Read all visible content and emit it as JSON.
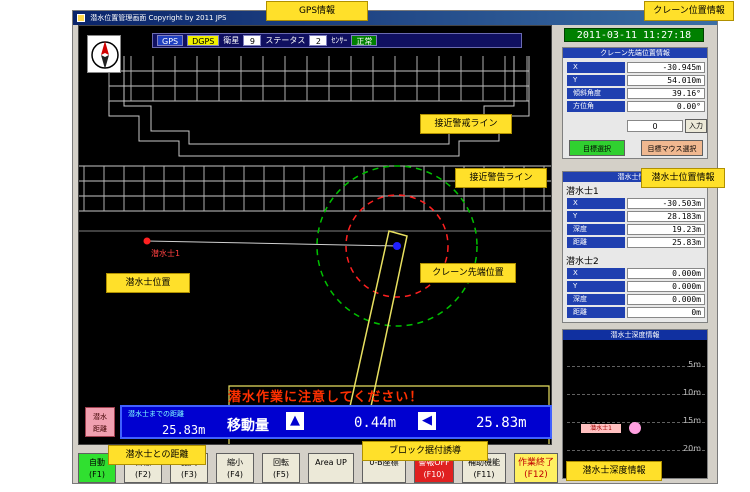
{
  "window": {
    "title": "潜水位置管理画面  Copyright by 2011 JPS"
  },
  "status_bar": {
    "gps": "GPS",
    "dgps": "DGPS",
    "sat_label": "衛星",
    "sat_count": "9",
    "status_label": "ステータス",
    "status_value": "2",
    "sensor_label": "ｾﾝｻｰ",
    "sensor_state": "正常"
  },
  "map": {
    "diver1_label": "潜水士1",
    "warning": "潜水作業に注意してください！"
  },
  "move_bar": {
    "caption": "潜水士までの距離",
    "diver_distance": "25.83m",
    "move_label": "移動量",
    "vertical_move": "0.44m",
    "horizontal_move": "25.83m"
  },
  "diver_dist_button": {
    "line1": "潜水",
    "line2": "距離"
  },
  "fkeys": [
    {
      "line1": "自動",
      "line2": "(F1)",
      "color": "green"
    },
    {
      "line1": "目標",
      "line2": "(F2)",
      "color": ""
    },
    {
      "line1": "拡大",
      "line2": "(F3)",
      "color": ""
    },
    {
      "line1": "縮小",
      "line2": "(F4)",
      "color": ""
    },
    {
      "line1": "回転",
      "line2": "(F5)",
      "color": ""
    },
    {
      "line1": "Area UP",
      "line2": "",
      "color": ""
    },
    {
      "line1": "0-B座標",
      "line2": "",
      "color": ""
    },
    {
      "line1": "警報OFF",
      "line2": "(F10)",
      "color": "red"
    },
    {
      "line1": "補助機能",
      "line2": "(F11)",
      "color": ""
    },
    {
      "line1": "作業終了",
      "line2": "(F12)",
      "color": "yellow"
    }
  ],
  "right": {
    "datetime": "2011-03-11  11:27:18",
    "crane_title": "クレーン先端位置情報",
    "crane_rows": [
      {
        "k": "X",
        "v": "-30.945m"
      },
      {
        "k": "Y",
        "v": "54.010m"
      },
      {
        "k": "傾斜角度",
        "v": "39.16°"
      },
      {
        "k": "方位角",
        "v": "0.00°"
      }
    ],
    "input_value": "0",
    "input_button": "入力",
    "target_select": "目標選択",
    "target_mouse": "目標マウス選択",
    "diver_title": "潜水士情報",
    "diver1": "潜水士1",
    "diver1_rows": [
      {
        "k": "X",
        "v": "-30.503m"
      },
      {
        "k": "Y",
        "v": "28.183m"
      },
      {
        "k": "深度",
        "v": "19.23m"
      },
      {
        "k": "距離",
        "v": "25.83m"
      }
    ],
    "diver2": "潜水士2",
    "diver2_rows": [
      {
        "k": "X",
        "v": "0.000m"
      },
      {
        "k": "Y",
        "v": "0.000m"
      },
      {
        "k": "深度",
        "v": "0.000m"
      },
      {
        "k": "距離",
        "v": "0m"
      }
    ],
    "depth_title": "潜水士深度情報",
    "depth_ticks": [
      "5m",
      "10m",
      "15m",
      "20m"
    ],
    "depth_marker": "潜水士1"
  },
  "callouts": {
    "gps_info": "GPS情報",
    "crane_info": "クレーン位置情報",
    "approach_warn_line": "接近警戒ライン",
    "approach_alarm_line": "接近警告ライン",
    "diver_pos_info": "潜水士位置情報",
    "diver_position": "潜水士位置",
    "crane_tip_position": "クレーン先端位置",
    "diver_distance": "潜水士との距離",
    "block_guide": "ブロック据付誘導",
    "diver_depth_info": "潜水士深度情報"
  },
  "colors": {
    "warn_ring": "#00c000",
    "alarm_ring": "#ff2020",
    "arm": "#e8e060",
    "crane_tip": "#2020ff",
    "diver": "#ff2020"
  }
}
